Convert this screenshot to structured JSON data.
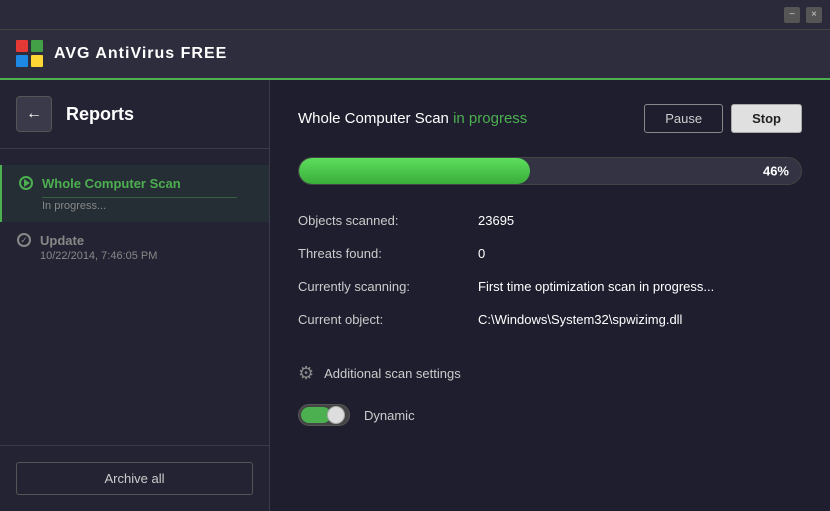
{
  "titleBar": {
    "minimizeLabel": "−",
    "closeLabel": "×"
  },
  "header": {
    "appName": "AVG  AntiVirus FREE",
    "avgText": "AVG"
  },
  "sidebar": {
    "title": "Reports",
    "backLabel": "←",
    "items": [
      {
        "name": "Whole Computer Scan",
        "status": "In progress...",
        "active": true,
        "iconType": "play"
      },
      {
        "name": "Update",
        "status": "10/22/2014, 7:46:05 PM",
        "active": false,
        "iconType": "check"
      }
    ],
    "archiveButtonLabel": "Archive all"
  },
  "content": {
    "scanTitle": "Whole Computer Scan",
    "scanStatus": "in progress",
    "pauseLabel": "Pause",
    "stopLabel": "Stop",
    "progress": {
      "percent": 46,
      "label": "46%"
    },
    "stats": [
      {
        "label": "Objects scanned:",
        "value": "23695"
      },
      {
        "label": "Threats found:",
        "value": "0"
      },
      {
        "label": "Currently scanning:",
        "value": "First time optimization scan in progress..."
      },
      {
        "label": "Current object:",
        "value": "C:\\Windows\\System32\\spwizimg.dll"
      }
    ],
    "additionalSettings": {
      "label": "Additional scan settings"
    },
    "toggle": {
      "label": "Dynamic"
    }
  }
}
